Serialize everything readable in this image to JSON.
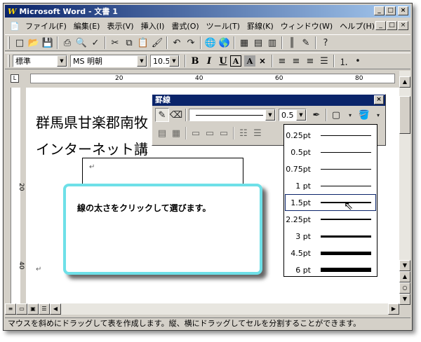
{
  "window": {
    "title": "Microsoft Word - 文書 1",
    "app_glyph": "W"
  },
  "outer_controls": [
    "_",
    "□",
    "×"
  ],
  "doc_controls": [
    "_",
    "□",
    "×"
  ],
  "menu": [
    "ファイル(F)",
    "編集(E)",
    "表示(V)",
    "挿入(I)",
    "書式(O)",
    "ツール(T)",
    "罫線(K)",
    "ウィンドウ(W)",
    "ヘルプ(H)"
  ],
  "formatting": {
    "style": "標準",
    "font": "MS 明朝",
    "size": "10.5",
    "bold": "B",
    "italic": "I",
    "underline": "U"
  },
  "ruler": {
    "marks": [
      "20",
      "40",
      "60",
      "80"
    ]
  },
  "vruler": {
    "marks": [
      "20",
      "40"
    ]
  },
  "document": {
    "line1": "群馬県甘楽郡南牧",
    "line2": "インターネット講",
    "para_mark": "↵"
  },
  "tables_toolbar": {
    "title": "罫線",
    "line_width": "0.5",
    "close": "×"
  },
  "line_widths": [
    {
      "label": "0.25pt",
      "pt": 0.25
    },
    {
      "label": "0.5pt",
      "pt": 0.5
    },
    {
      "label": "0.75pt",
      "pt": 0.75
    },
    {
      "label": "1 pt",
      "pt": 1
    },
    {
      "label": "1.5pt",
      "pt": 1.5
    },
    {
      "label": "2.25pt",
      "pt": 2.25
    },
    {
      "label": "3 pt",
      "pt": 3
    },
    {
      "label": "4.5pt",
      "pt": 4.5
    },
    {
      "label": "6 pt",
      "pt": 6
    }
  ],
  "selected_width": "1.5pt",
  "callout": {
    "text": "線の太さをクリックして選びます。"
  },
  "status": {
    "text": "マウスを斜めにドラッグして表を作成します。縦、横にドラッグしてセルを分割することができます。"
  }
}
